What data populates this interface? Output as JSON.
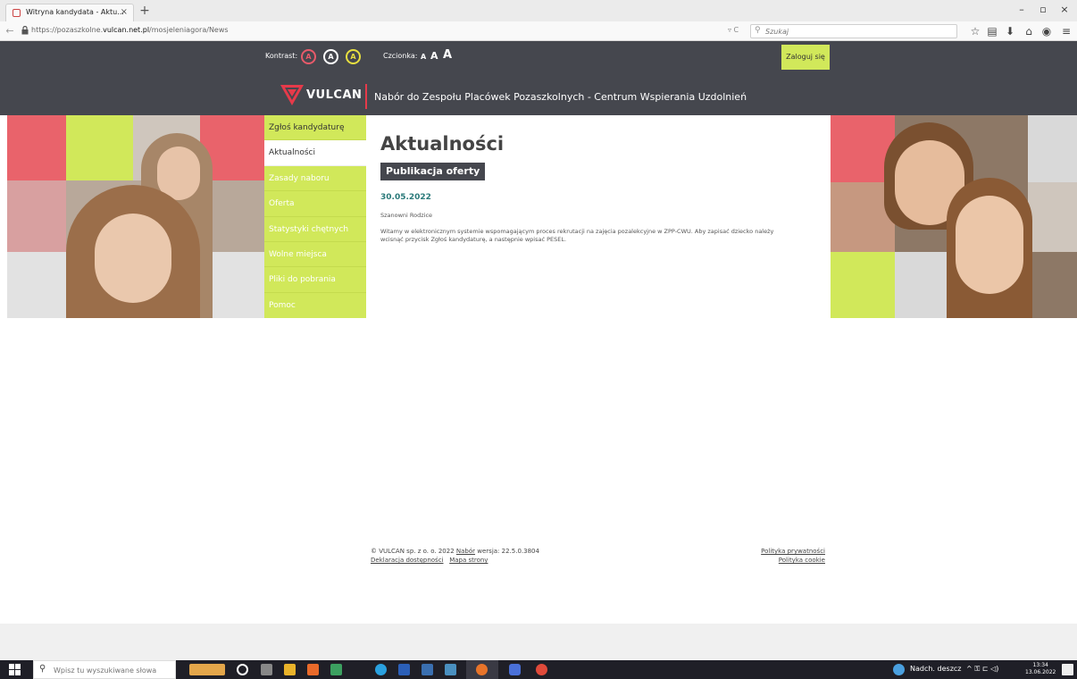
{
  "browser": {
    "tab_title": "Witryna kandydata - Aktu...",
    "tab_close": "×",
    "new_tab": "+",
    "url_prefix": "https://pozaszkolne.",
    "url_domain": "vulcan.net.pl",
    "url_path": "/mosjeleniagora/News",
    "url_tools": "▿ C",
    "search_placeholder": "Szukaj",
    "window_controls": [
      "–",
      "▫",
      "×"
    ],
    "toolbar_icons": [
      "star-icon",
      "reading-list-icon",
      "download-icon",
      "home-icon",
      "pocket-icon",
      "menu-icon"
    ]
  },
  "accessibility": {
    "kontrast_label": "Kontrast:",
    "kontrast_buttons": [
      "A",
      "A",
      "A"
    ],
    "czcionka_label": "Czcionka:",
    "font_sizes": [
      "A",
      "A",
      "A"
    ]
  },
  "header": {
    "login_label": "Zaloguj się",
    "logo_text": "VULCAN",
    "site_title": "Nabór do Zespołu Placówek Pozaszkolnych - Centrum Wspierania Uzdolnień"
  },
  "menu": {
    "items": [
      {
        "label": "Zgłoś kandydaturę"
      },
      {
        "label": "Aktualności"
      },
      {
        "label": "Zasady naboru"
      },
      {
        "label": "Oferta"
      },
      {
        "label": "Statystyki chętnych"
      },
      {
        "label": "Wolne miejsca"
      },
      {
        "label": "Pliki do pobrania"
      },
      {
        "label": "Pomoc"
      }
    ],
    "active_index": 1
  },
  "content": {
    "page_title": "Aktualności",
    "news_title": "Publikacja oferty",
    "news_date": "30.05.2022",
    "greeting": "Szanowni Rodzice",
    "body_line1": "Witamy w elektronicznym systemie wspomagającym proces rekrutacji na zajęcia pozalekcyjne w ZPP-CWU. Aby zapisać dziecko należy",
    "body_line2": "wcisnąć przycisk Zgłoś kandydaturę, a następnie wpisać PESEL."
  },
  "footer": {
    "copyright": "© VULCAN sp. z o. o. 2022",
    "nabor_link": "Nabór",
    "version": "wersja: 22.5.0.3804",
    "accessibility_link": "Deklaracja dostępności",
    "sitemap_link": "Mapa strony",
    "privacy_link": "Polityka prywatności",
    "cookie_link": "Polityka cookie"
  },
  "taskbar": {
    "search_placeholder": "Wpisz tu wyszukiwane słowa",
    "weather": "Nadch. deszcz",
    "time": "13:34",
    "date": "13.06.2022"
  },
  "colors": {
    "header_bg": "#45474e",
    "accent_green": "#d1e85a",
    "accent_red": "#e63a4a",
    "date_teal": "#2b7a7a"
  }
}
